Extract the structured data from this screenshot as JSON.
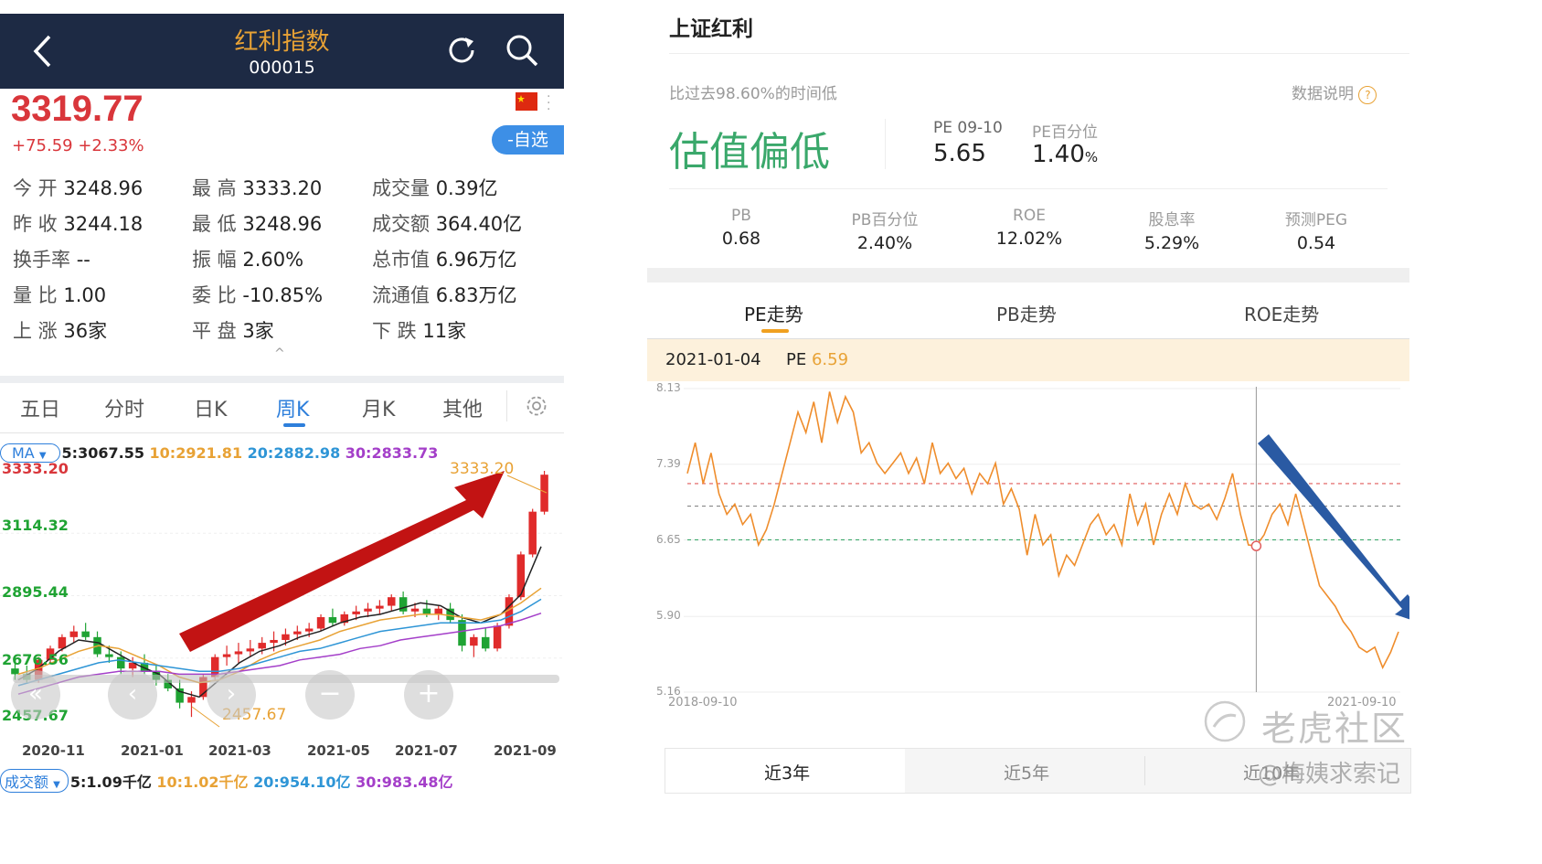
{
  "left": {
    "header": {
      "title": "红利指数",
      "code": "000015"
    },
    "price": "3319.77",
    "change": "+75.59 +2.33%",
    "watch_button": "-自选",
    "stats": [
      {
        "label": "今  开",
        "value": "3248.96"
      },
      {
        "label": "最  高",
        "value": "3333.20"
      },
      {
        "label": "成交量",
        "value": "0.39亿"
      },
      {
        "label": "昨  收",
        "value": "3244.18"
      },
      {
        "label": "最  低",
        "value": "3248.96"
      },
      {
        "label": "成交额",
        "value": "364.40亿"
      },
      {
        "label": "换手率",
        "value": "--"
      },
      {
        "label": "振  幅",
        "value": "2.60%"
      },
      {
        "label": "总市值",
        "value": "6.96万亿"
      },
      {
        "label": "量  比",
        "value": "1.00"
      },
      {
        "label": "委  比",
        "value": "-10.85%"
      },
      {
        "label": "流通值",
        "value": "6.83万亿"
      },
      {
        "label": "上  涨",
        "value": "36家"
      },
      {
        "label": "平  盘",
        "value": "3家"
      },
      {
        "label": "下  跌",
        "value": "11家"
      }
    ],
    "tabs": [
      "五日",
      "分时",
      "日K",
      "周K",
      "月K",
      "其他"
    ],
    "active_tab": "周K",
    "ma": {
      "selector": "MA",
      "ma5": "5:3067.55",
      "ma10": "10:2921.81",
      "ma20": "20:2882.98",
      "ma30": "30:2833.73"
    },
    "y_labels": [
      "3333.20",
      "3114.32",
      "2895.44",
      "2676.56",
      "2457.67"
    ],
    "high_annotation": "3333.20",
    "low_annotation": "2457.67",
    "x_labels": [
      "2020-11",
      "2021-01",
      "2021-03",
      "2021-05",
      "2021-07",
      "2021-09"
    ],
    "volume": {
      "selector": "成交额",
      "v5": "5:1.09千亿",
      "v10": "10:1.02千亿",
      "v20": "20:954.10亿",
      "v30": "30:983.48亿"
    },
    "colors": {
      "up": "#e02b2b",
      "down": "#1fa333",
      "ma5": "#222222",
      "ma10": "#e8a235",
      "ma20": "#2e95d6",
      "ma30": "#a43fc9"
    }
  },
  "right": {
    "title": "上证红利",
    "compare_text": "比过去98.60%的时间低",
    "data_note": "数据说明",
    "valuation": "估值偏低",
    "pe_label": "PE 09-10",
    "pe_value": "5.65",
    "pe_pct_label": "PE百分位",
    "pe_pct_value": "1.40",
    "pe_pct_unit": "%",
    "metrics": [
      {
        "label": "PB",
        "value": "0.68"
      },
      {
        "label": "PB百分位",
        "value": "2.40%"
      },
      {
        "label": "ROE",
        "value": "12.02%"
      },
      {
        "label": "股息率",
        "value": "5.29%"
      },
      {
        "label": "预测PEG",
        "value": "0.54"
      }
    ],
    "tabs": [
      "PE走势",
      "PB走势",
      "ROE走势"
    ],
    "active_tab": "PE走势",
    "cursor_date": "2021-01-04",
    "cursor_pe_label": "PE",
    "cursor_pe_value": "6.59",
    "y_labels": [
      "8.13",
      "7.39",
      "6.65",
      "5.90",
      "5.16"
    ],
    "x_start": "2018-09-10",
    "x_end": "2021-09-10",
    "periods": [
      "近3年",
      "近5年",
      "近10年"
    ],
    "watermark1": "老虎社区",
    "watermark2": "@梅姨求索记"
  },
  "chart_data": [
    {
      "type": "candlestick",
      "title": "",
      "x_labels": [
        "2020-11",
        "2021-01",
        "2021-03",
        "2021-05",
        "2021-07",
        "2021-09"
      ],
      "ylim": [
        2457.67,
        3333.2
      ],
      "ohlc": [
        [
          2640,
          2660,
          2600,
          2620
        ],
        [
          2620,
          2650,
          2590,
          2600
        ],
        [
          2600,
          2680,
          2590,
          2670
        ],
        [
          2670,
          2720,
          2660,
          2710
        ],
        [
          2710,
          2760,
          2700,
          2750
        ],
        [
          2750,
          2790,
          2730,
          2770
        ],
        [
          2770,
          2800,
          2740,
          2750
        ],
        [
          2750,
          2770,
          2680,
          2690
        ],
        [
          2690,
          2720,
          2660,
          2680
        ],
        [
          2680,
          2700,
          2620,
          2640
        ],
        [
          2640,
          2680,
          2610,
          2660
        ],
        [
          2660,
          2690,
          2620,
          2630
        ],
        [
          2630,
          2650,
          2580,
          2600
        ],
        [
          2600,
          2620,
          2560,
          2570
        ],
        [
          2570,
          2600,
          2500,
          2520
        ],
        [
          2520,
          2560,
          2470,
          2540
        ],
        [
          2540,
          2620,
          2530,
          2610
        ],
        [
          2610,
          2690,
          2600,
          2680
        ],
        [
          2680,
          2720,
          2650,
          2690
        ],
        [
          2690,
          2730,
          2660,
          2700
        ],
        [
          2700,
          2740,
          2680,
          2710
        ],
        [
          2710,
          2750,
          2690,
          2730
        ],
        [
          2730,
          2770,
          2700,
          2740
        ],
        [
          2740,
          2780,
          2720,
          2760
        ],
        [
          2760,
          2790,
          2740,
          2770
        ],
        [
          2770,
          2800,
          2750,
          2780
        ],
        [
          2780,
          2830,
          2770,
          2820
        ],
        [
          2820,
          2850,
          2790,
          2800
        ],
        [
          2800,
          2840,
          2790,
          2830
        ],
        [
          2830,
          2860,
          2810,
          2840
        ],
        [
          2840,
          2870,
          2820,
          2850
        ],
        [
          2850,
          2880,
          2830,
          2860
        ],
        [
          2860,
          2900,
          2840,
          2890
        ],
        [
          2890,
          2910,
          2830,
          2840
        ],
        [
          2840,
          2870,
          2820,
          2850
        ],
        [
          2850,
          2880,
          2820,
          2830
        ],
        [
          2830,
          2860,
          2810,
          2850
        ],
        [
          2850,
          2870,
          2800,
          2810
        ],
        [
          2810,
          2830,
          2700,
          2720
        ],
        [
          2720,
          2760,
          2680,
          2750
        ],
        [
          2750,
          2780,
          2700,
          2710
        ],
        [
          2710,
          2800,
          2700,
          2790
        ],
        [
          2790,
          2900,
          2780,
          2890
        ],
        [
          2890,
          3050,
          2880,
          3040
        ],
        [
          3040,
          3200,
          3030,
          3190
        ],
        [
          3190,
          3333.2,
          3180,
          3319.77
        ]
      ],
      "series": [
        {
          "name": "MA5",
          "values": [
            2600,
            2640,
            2700,
            2740,
            2730,
            2690,
            2650,
            2620,
            2560,
            2540,
            2600,
            2660,
            2700,
            2720,
            2750,
            2770,
            2800,
            2820,
            2830,
            2850,
            2870,
            2860,
            2820,
            2800,
            2830,
            2900,
            3067.55
          ]
        },
        {
          "name": "MA10",
          "values": [
            2620,
            2640,
            2670,
            2700,
            2720,
            2710,
            2680,
            2650,
            2610,
            2590,
            2600,
            2630,
            2670,
            2700,
            2720,
            2740,
            2770,
            2790,
            2810,
            2820,
            2830,
            2830,
            2820,
            2810,
            2830,
            2870,
            2921.81
          ]
        },
        {
          "name": "MA20",
          "values": [
            2580,
            2600,
            2620,
            2640,
            2660,
            2670,
            2660,
            2650,
            2640,
            2630,
            2630,
            2640,
            2660,
            2680,
            2700,
            2710,
            2730,
            2750,
            2770,
            2780,
            2790,
            2800,
            2800,
            2800,
            2810,
            2840,
            2882.98
          ]
        },
        {
          "name": "MA30",
          "values": [
            2550,
            2570,
            2590,
            2610,
            2620,
            2630,
            2630,
            2630,
            2620,
            2620,
            2620,
            2630,
            2640,
            2650,
            2670,
            2680,
            2690,
            2710,
            2720,
            2740,
            2750,
            2760,
            2770,
            2780,
            2790,
            2810,
            2833.73
          ]
        }
      ]
    },
    {
      "type": "line",
      "title": "",
      "x_start": "2018-09-10",
      "x_end": "2021-09-10",
      "ylim": [
        5.16,
        8.13
      ],
      "reference_lines": [
        7.2,
        6.98,
        6.65
      ],
      "cursor": {
        "date": "2021-01-04",
        "value": 6.59
      },
      "values": [
        7.3,
        7.6,
        7.2,
        7.5,
        7.1,
        6.9,
        7.0,
        6.8,
        6.9,
        6.6,
        6.75,
        7.0,
        7.3,
        7.6,
        7.9,
        7.7,
        8.0,
        7.6,
        8.1,
        7.8,
        8.05,
        7.9,
        7.5,
        7.6,
        7.4,
        7.3,
        7.4,
        7.5,
        7.3,
        7.45,
        7.2,
        7.6,
        7.3,
        7.4,
        7.25,
        7.35,
        7.1,
        7.3,
        7.2,
        7.4,
        7.0,
        7.15,
        6.95,
        6.5,
        6.9,
        6.6,
        6.7,
        6.3,
        6.5,
        6.4,
        6.6,
        6.8,
        6.9,
        6.7,
        6.8,
        6.6,
        7.1,
        6.8,
        7.0,
        6.6,
        6.9,
        7.1,
        6.9,
        7.2,
        7.0,
        6.95,
        7.0,
        6.85,
        7.05,
        7.3,
        6.9,
        6.6,
        6.59,
        6.7,
        6.9,
        7.0,
        6.8,
        7.1,
        6.8,
        6.5,
        6.2,
        6.1,
        6.0,
        5.85,
        5.75,
        5.6,
        5.55,
        5.6,
        5.4,
        5.55,
        5.75
      ]
    }
  ]
}
